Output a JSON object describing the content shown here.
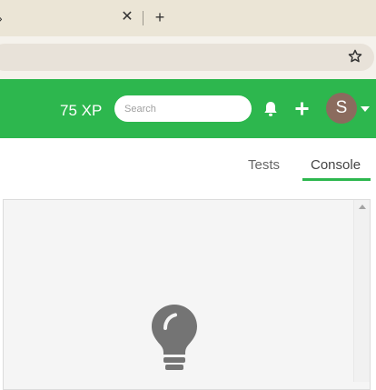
{
  "browser": {
    "tab": {
      "partial_label": "›",
      "close_label": "✕"
    },
    "new_tab_label": "+",
    "bookmark_icon": "star-icon"
  },
  "header": {
    "xp": "75 XP",
    "search": {
      "placeholder": "Search"
    },
    "icons": [
      "bell-icon",
      "plus-icon",
      "caret-down-icon"
    ],
    "avatar_initial": "S",
    "colors": {
      "bar": "#2db74e",
      "avatar": "#8b6b5e"
    }
  },
  "panel_tabs": {
    "items": [
      {
        "label": "Tests",
        "active": false
      },
      {
        "label": "Console",
        "active": true
      }
    ]
  },
  "console": {
    "icon": "lightbulb-icon"
  }
}
